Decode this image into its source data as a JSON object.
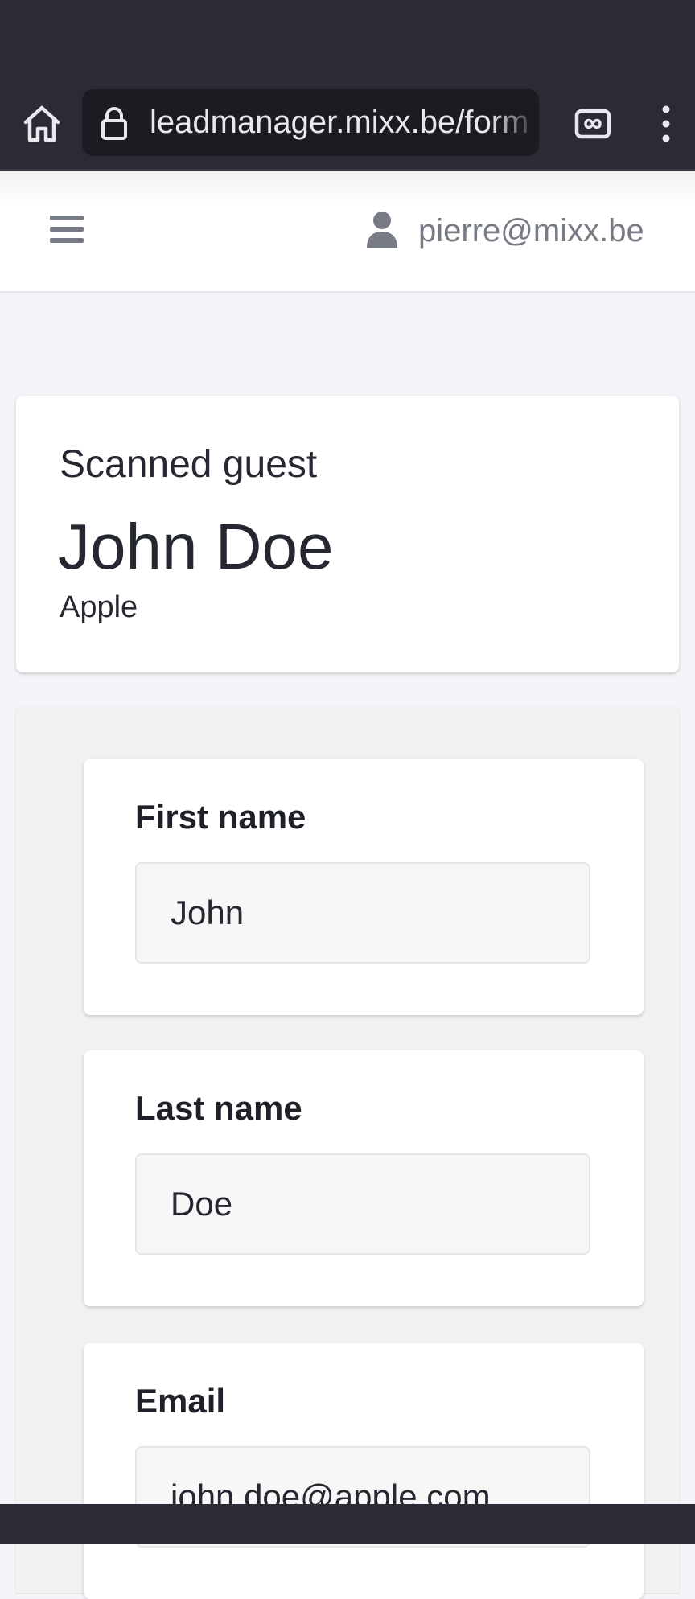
{
  "browser": {
    "url": "leadmanager.mixx.be/form"
  },
  "header": {
    "user_email": "pierre@mixx.be"
  },
  "guest_card": {
    "kicker": "Scanned guest",
    "name": "John Doe",
    "company": "Apple"
  },
  "form": {
    "fields": [
      {
        "label": "First name",
        "value": "John"
      },
      {
        "label": "Last name",
        "value": "Doe"
      },
      {
        "label": "Email",
        "value": "john.doe@apple.com"
      }
    ]
  },
  "icons": {
    "home": "home-icon",
    "lock": "lock-icon",
    "tabs": "tab-switcher-icon",
    "menu": "more-vert-icon",
    "hamburger": "hamburger-icon",
    "user": "user-icon"
  },
  "colors": {
    "browser_chrome": "#2b2a35",
    "page_background": "#f4f5f8",
    "text": "#252830"
  }
}
